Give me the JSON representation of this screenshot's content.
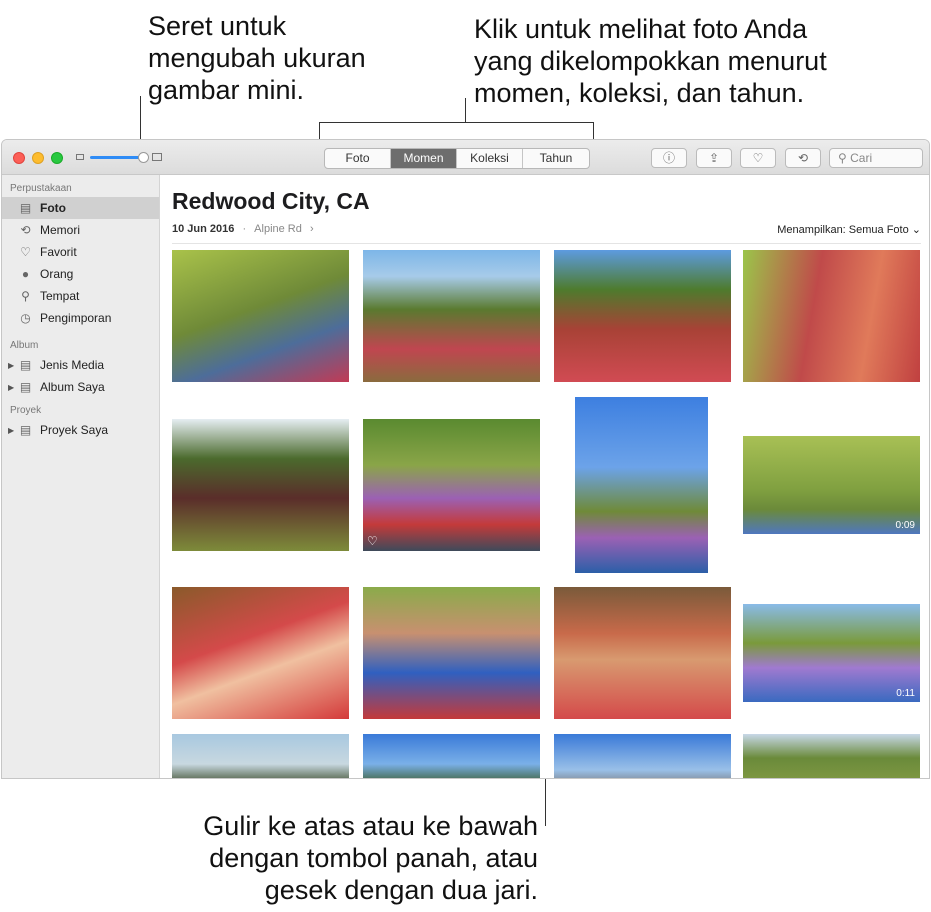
{
  "callouts": {
    "resize": [
      "Seret untuk",
      "mengubah ukuran",
      "gambar mini."
    ],
    "tabs": [
      "Klik untuk melihat foto Anda",
      "yang dikelompokkan menurut",
      "momen, koleksi, dan tahun."
    ],
    "scroll": [
      "Gulir ke atas atau ke bawah",
      "dengan tombol panah, atau",
      "gesek dengan dua jari."
    ]
  },
  "toolbar": {
    "tabs": [
      "Foto",
      "Momen",
      "Koleksi",
      "Tahun"
    ],
    "active_tab": "Momen",
    "search_placeholder": "Cari",
    "buttons": [
      {
        "icon": "info-icon",
        "glyph": "ⓘ"
      },
      {
        "icon": "share-icon",
        "glyph": "⇪"
      },
      {
        "icon": "heart-icon",
        "glyph": "♡"
      },
      {
        "icon": "rotate-icon",
        "glyph": "⟲"
      }
    ]
  },
  "sidebar": {
    "library_header": "Perpustakaan",
    "library_items": [
      {
        "label": "Foto",
        "icon": "photos-icon",
        "glyph": "▤",
        "selected": true
      },
      {
        "label": "Memori",
        "icon": "memories-icon",
        "glyph": "⟲"
      },
      {
        "label": "Favorit",
        "icon": "heart-icon",
        "glyph": "♡"
      },
      {
        "label": "Orang",
        "icon": "person-icon",
        "glyph": "●"
      },
      {
        "label": "Tempat",
        "icon": "pin-icon",
        "glyph": "⚲"
      },
      {
        "label": "Pengimporan",
        "icon": "clock-icon",
        "glyph": "◷"
      }
    ],
    "album_header": "Album",
    "album_items": [
      {
        "label": "Jenis Media",
        "icon": "folder-icon"
      },
      {
        "label": "Album Saya",
        "icon": "folder-icon"
      }
    ],
    "project_header": "Proyek",
    "project_items": [
      {
        "label": "Proyek Saya",
        "icon": "folder-icon"
      }
    ]
  },
  "main": {
    "title": "Redwood City, CA",
    "date": "10 Jun 2016",
    "separator": "·",
    "location": "Alpine Rd",
    "location_chevron": "›",
    "showing": "Menampilkan: Semua Foto",
    "showing_chevron": "⌄"
  },
  "photos": [
    {
      "id": "p1"
    },
    {
      "id": "p2"
    },
    {
      "id": "p3"
    },
    {
      "id": "p4"
    },
    {
      "id": "p5"
    },
    {
      "id": "p6",
      "favorite": true
    },
    {
      "id": "p7"
    },
    {
      "id": "p8",
      "duration": "0:09"
    },
    {
      "id": "p9"
    },
    {
      "id": "p10"
    },
    {
      "id": "p11"
    },
    {
      "id": "p12",
      "duration": "0:11"
    },
    {
      "id": "p13"
    },
    {
      "id": "p14"
    },
    {
      "id": "p15"
    },
    {
      "id": "p16"
    }
  ]
}
